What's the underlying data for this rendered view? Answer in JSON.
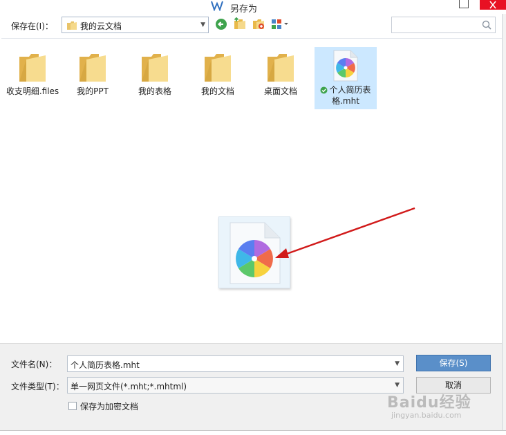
{
  "window": {
    "title": "另存为"
  },
  "toolbar": {
    "save_in_label": "保存在(I)：",
    "location": "我的云文档",
    "search_placeholder": ""
  },
  "files": [
    {
      "name": "收支明细.files",
      "type": "folder"
    },
    {
      "name": "我的PPT",
      "type": "folder"
    },
    {
      "name": "我的表格",
      "type": "folder"
    },
    {
      "name": "我的文档",
      "type": "folder"
    },
    {
      "name": "桌面文档",
      "type": "folder"
    },
    {
      "name": "个人简历表格.mht",
      "type": "mht",
      "selected": true,
      "synced": true
    }
  ],
  "footer": {
    "filename_label": "文件名(N)：",
    "filename_value": "个人简历表格.mht",
    "filetype_label": "文件类型(T)：",
    "filetype_value": "单一网页文件(*.mht;*.mhtml)",
    "save_button": "保存(S)",
    "cancel_button": "取消",
    "encrypt_label": "保存为加密文档"
  },
  "watermark": {
    "main": "Baidu经验",
    "sub": "jingyan.baidu.com"
  },
  "colors": {
    "accent": "#5a8fc9",
    "selection": "#cce8ff",
    "close": "#e81123",
    "arrow": "#d11a1a"
  }
}
